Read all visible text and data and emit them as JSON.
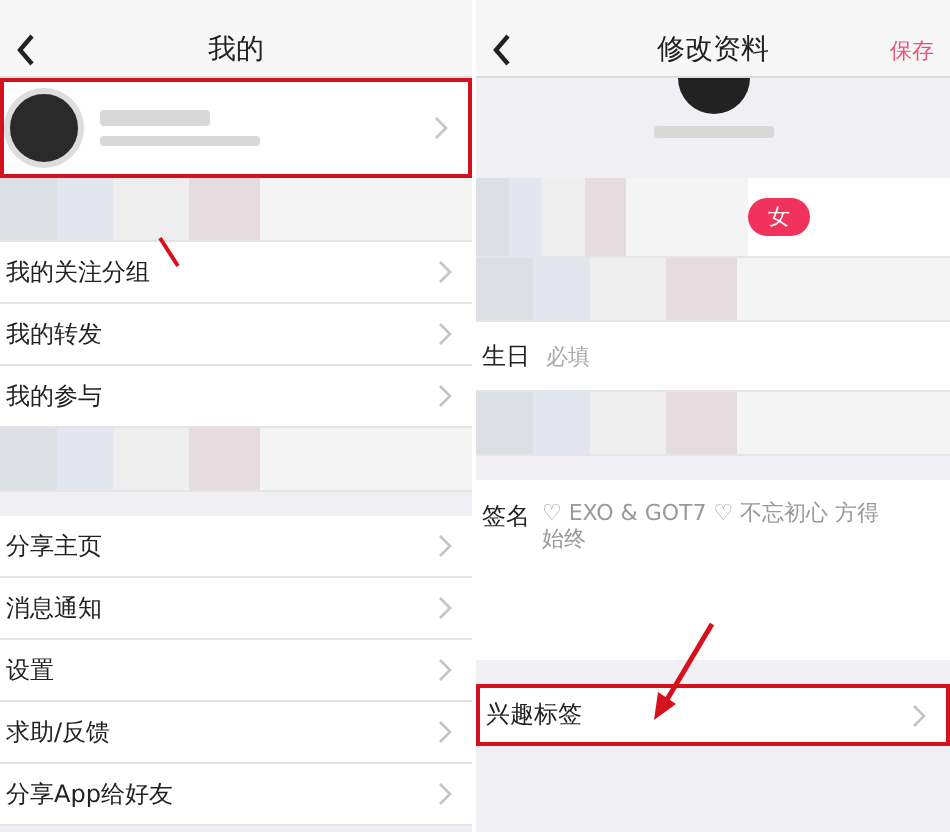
{
  "left": {
    "title": "我的",
    "sections": [
      {
        "rows": [
          {
            "kind": "profile",
            "highlighted": true
          }
        ]
      },
      {
        "rows": [
          {
            "kind": "blurred",
            "highlighted": false
          },
          {
            "kind": "item",
            "label": "我的关注分组",
            "highlighted": false
          },
          {
            "kind": "item",
            "label": "我的转发",
            "highlighted": false
          },
          {
            "kind": "item",
            "label": "我的参与",
            "highlighted": false
          },
          {
            "kind": "blurred",
            "highlighted": false
          }
        ]
      },
      {
        "rows": [
          {
            "kind": "item",
            "label": "分享主页",
            "highlighted": false
          },
          {
            "kind": "item",
            "label": "消息通知",
            "highlighted": false
          },
          {
            "kind": "item",
            "label": "设置",
            "highlighted": false
          },
          {
            "kind": "item",
            "label": "求助/反馈",
            "highlighted": false
          },
          {
            "kind": "item",
            "label": "分享App给好友",
            "highlighted": false
          }
        ]
      }
    ]
  },
  "right": {
    "title": "修改资料",
    "action": "保存",
    "sections": [
      {
        "rows": [
          {
            "kind": "header",
            "highlighted": false
          }
        ]
      },
      {
        "rows": [
          {
            "kind": "gender",
            "badge": "女",
            "highlighted": false
          },
          {
            "kind": "blurred",
            "highlighted": false
          },
          {
            "kind": "field",
            "label": "生日",
            "placeholder": "必填",
            "highlighted": false
          },
          {
            "kind": "blurred",
            "highlighted": false
          }
        ]
      },
      {
        "rows": [
          {
            "kind": "signature",
            "label": "签名",
            "value": "♡ EXO & GOT7 ♡ 不忘初心 方得始终",
            "highlighted": false
          }
        ]
      },
      {
        "rows": [
          {
            "kind": "item",
            "label": "兴趣标签",
            "highlighted": true
          }
        ]
      }
    ]
  }
}
